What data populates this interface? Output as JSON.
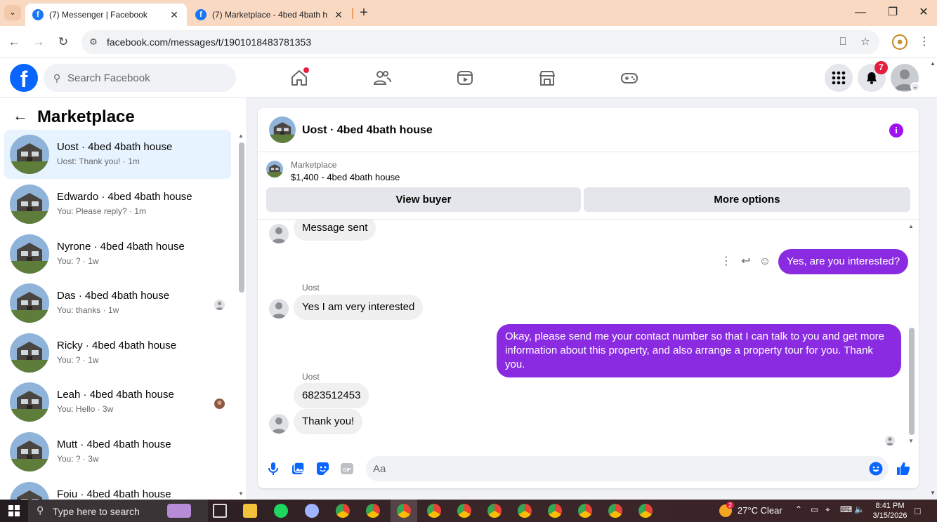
{
  "browser": {
    "tabs": [
      {
        "title": "(7) Messenger | Facebook",
        "active": true
      },
      {
        "title": "(7) Marketplace - 4bed 4bath h",
        "active": false
      }
    ],
    "url": "facebook.com/messages/t/1901018483781353"
  },
  "fb_header": {
    "logo_letter": "f",
    "search_placeholder": "Search Facebook",
    "notification_count": "7"
  },
  "sidebar": {
    "title": "Marketplace",
    "conversations": [
      {
        "name": "Uost · 4bed 4bath house",
        "preview": "Uost: Thank you! · 1m",
        "selected": true
      },
      {
        "name": "Edwardo · 4bed 4bath house",
        "preview": "You: Please reply? · 1m"
      },
      {
        "name": "Nyrone · 4bed 4bath house",
        "preview": "You: ? · 1w"
      },
      {
        "name": "Das · 4bed 4bath house",
        "preview": "You: thanks · 1w"
      },
      {
        "name": "Ricky · 4bed 4bath house",
        "preview": "You: ? · 1w"
      },
      {
        "name": "Leah · 4bed 4bath house",
        "preview": "You: Hello · 3w"
      },
      {
        "name": "Mutt · 4bed 4bath house",
        "preview": "You: ? · 3w"
      },
      {
        "name": "Foiu · 4bed 4bath house",
        "preview": ""
      }
    ]
  },
  "chat": {
    "title": "Uost · 4bed 4bath house",
    "listing_source": "Marketplace",
    "listing_price_title": "$1,400 - 4bed 4bath house",
    "view_buyer_label": "View buyer",
    "more_options_label": "More options",
    "messages": [
      {
        "from": "them",
        "text": "Message sent"
      },
      {
        "from": "me",
        "text": "Yes, are you interested?"
      },
      {
        "from": "them",
        "sender": "Uost",
        "text": "Yes I am very interested"
      },
      {
        "from": "me",
        "text": "Okay, please send me your contact number so that I can talk to you and get more information about this property, and also arrange a property tour for you. Thank you."
      },
      {
        "from": "them",
        "sender": "Uost",
        "text": "6823512453"
      },
      {
        "from": "them",
        "text": "Thank you!"
      }
    ],
    "composer_placeholder": "Aa"
  },
  "taskbar": {
    "search_placeholder": "Type here to search",
    "weather": "27°C  Clear",
    "weather_badge": "2",
    "time": "8:41 PM",
    "date": "3/15/2026"
  },
  "colors": {
    "fb_blue": "#0866ff",
    "outgoing_bubble": "#8a2be2",
    "incoming_bubble": "#f0f0f0",
    "tab_bar": "#f9d9c2"
  }
}
